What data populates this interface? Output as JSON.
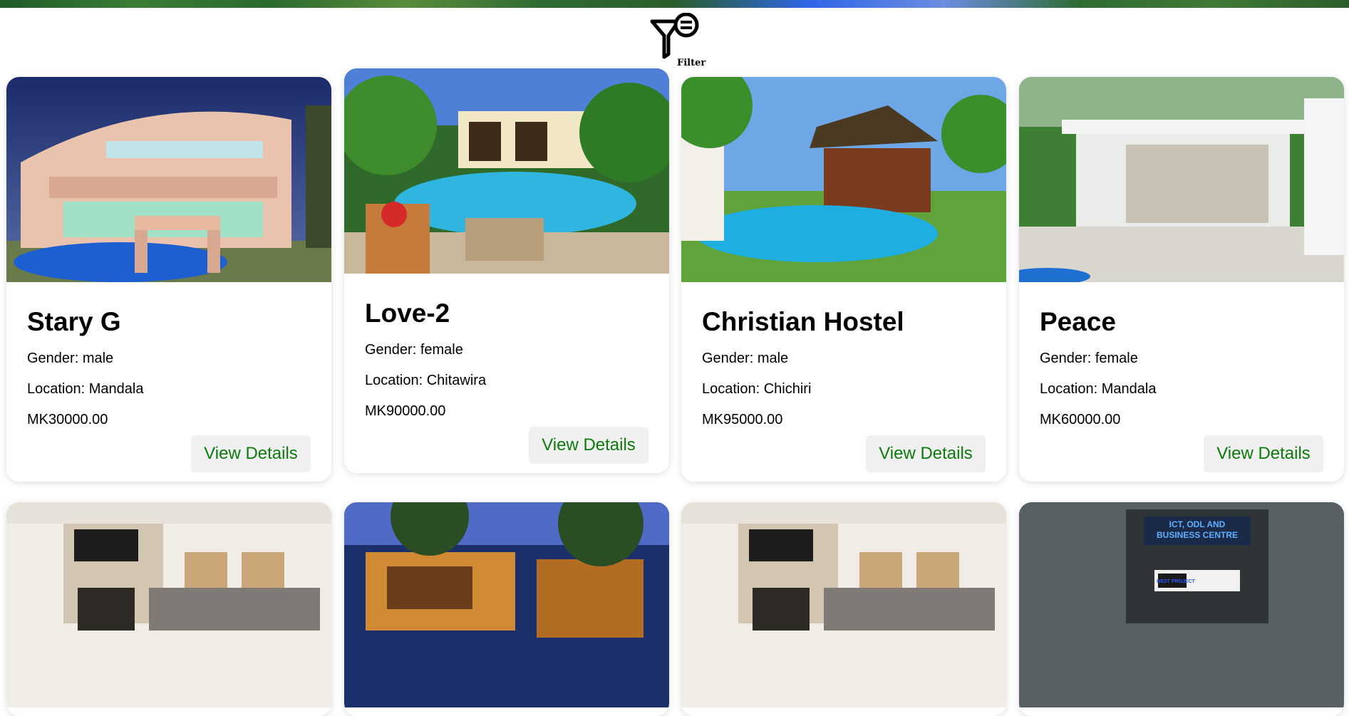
{
  "filter": {
    "label": "Filter"
  },
  "hostels": [
    {
      "name": "Stary G",
      "gender": "Gender: male",
      "location": "Location: Mandala",
      "price": "MK30000.00",
      "button": "View Details"
    },
    {
      "name": "Love-2",
      "gender": "Gender: female",
      "location": "Location: Chitawira",
      "price": "MK90000.00",
      "button": "View Details"
    },
    {
      "name": "Christian Hostel",
      "gender": "Gender: male",
      "location": "Location: Chichiri",
      "price": "MK95000.00",
      "button": "View Details"
    },
    {
      "name": "Peace",
      "gender": "Gender: female",
      "location": "Location: Mandala",
      "price": "MK60000.00",
      "button": "View Details"
    }
  ],
  "second_row": {
    "sign_line1": "ICT, ODL AND",
    "sign_line2": "BUSINESS CENTRE",
    "small_sign": "BEST PROJECT"
  }
}
